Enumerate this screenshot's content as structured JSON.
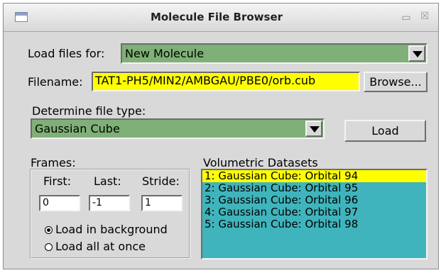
{
  "window": {
    "title": "Molecule File Browser",
    "minimize_glyph": "▭",
    "close_glyph": "☒"
  },
  "load_for": {
    "label": "Load files for:",
    "value": "New Molecule"
  },
  "filename": {
    "label": "Filename:",
    "value": "TAT1-PH5/MIN2/AMBGAU/PBE0/orb.cub",
    "browse_label": "Browse..."
  },
  "file_type": {
    "label": "Determine file type:",
    "value": "Gaussian Cube",
    "load_label": "Load"
  },
  "frames": {
    "label": "Frames:",
    "first_label": "First:",
    "last_label": "Last:",
    "stride_label": "Stride:",
    "first_value": "0",
    "last_value": "-1",
    "stride_value": "1",
    "radio_background": "Load in background",
    "radio_all": "Load all at once"
  },
  "datasets": {
    "label": "Volumetric Datasets",
    "items": [
      "1: Gaussian Cube: Orbital 94",
      "2: Gaussian Cube: Orbital 95",
      "3: Gaussian Cube: Orbital 96",
      "4: Gaussian Cube: Orbital 97",
      "5: Gaussian Cube: Orbital 98"
    ],
    "selected_index": 0
  },
  "colors": {
    "combo_green": "#7fb077",
    "highlight_yellow": "#ffff00",
    "list_teal": "#3fb4bc",
    "window_gray": "#d9d9d9"
  }
}
